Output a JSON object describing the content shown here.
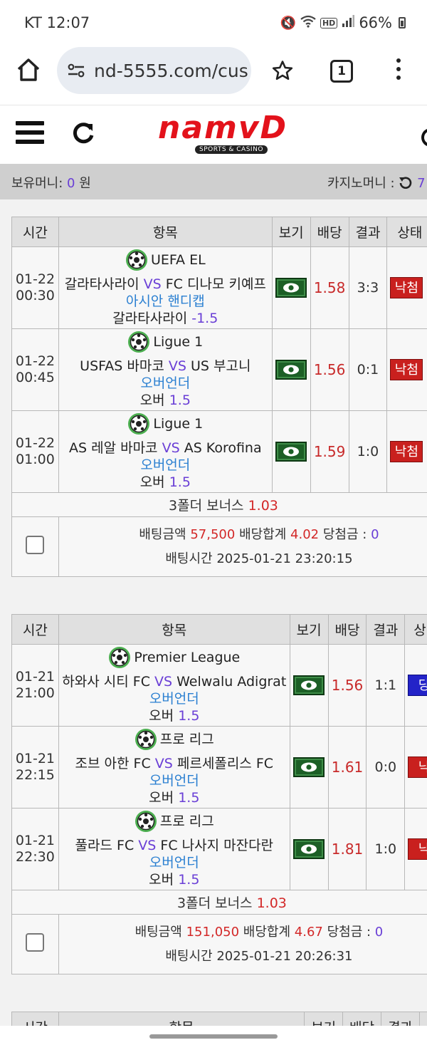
{
  "status_bar": {
    "carrier_time": "KT 12:07",
    "battery": "66%"
  },
  "browser": {
    "url": "nd-5555.com/cus",
    "tab_count": "1"
  },
  "site": {
    "logo": "namvD",
    "logo_sub": "SPORTS & CASINO"
  },
  "money_bar": {
    "holding_label": "보유머니:",
    "holding_value": "0",
    "holding_unit": "원",
    "casino_label": "카지노머니 :",
    "casino_value": "7"
  },
  "bet_slips": [
    {
      "headers": [
        "시간",
        "항목",
        "보기",
        "배당",
        "결과",
        "상태"
      ],
      "rows": [
        {
          "date": "01-22",
          "time": "00:30",
          "league": "UEFA EL",
          "home": "갈라타사라이",
          "vs": "VS",
          "away": "FC 디나모 키예프",
          "market": "아시안 핸디캡",
          "pick": "갈라타사라이",
          "pick_value": "-1.5",
          "odds": "1.58",
          "result": "3:3",
          "status": "낙첨",
          "status_color": "#c9201e"
        },
        {
          "date": "01-22",
          "time": "00:45",
          "league": "Ligue 1",
          "home": "USFAS 바마코",
          "vs": "VS",
          "away": "US 부고니",
          "market": "오버언더",
          "pick": "오버",
          "pick_value": "1.5",
          "odds": "1.56",
          "result": "0:1",
          "status": "낙첨",
          "status_color": "#c9201e"
        },
        {
          "date": "01-22",
          "time": "01:00",
          "league": "Ligue 1",
          "home": "AS 레알 바마코",
          "vs": "VS",
          "away": "AS Korofina",
          "market": "오버언더",
          "pick": "오버",
          "pick_value": "1.5",
          "odds": "1.59",
          "result": "1:0",
          "status": "낙첨",
          "status_color": "#c9201e"
        }
      ],
      "bonus_label": "3폴더 보너스",
      "bonus_value": "1.03",
      "amount_label": "배팅금액",
      "amount_value": "57,500",
      "total_odds_label": "배당합계",
      "total_odds_value": "4.02",
      "win_label": "당첨금 :",
      "win_value": "0",
      "bet_time_label": "배팅시간",
      "bet_time_value": "2025-01-21 23:20:15"
    },
    {
      "headers": [
        "시간",
        "항목",
        "보기",
        "배당",
        "결과",
        "상"
      ],
      "rows": [
        {
          "date": "01-21",
          "time": "21:00",
          "league": "Premier League",
          "home": "하와사 시티 FC",
          "vs": "VS",
          "away": "Welwalu Adigrat",
          "market": "오버언더",
          "pick": "오버",
          "pick_value": "1.5",
          "odds": "1.56",
          "result": "1:1",
          "status": "당",
          "status_color": "#2323c8"
        },
        {
          "date": "01-21",
          "time": "22:15",
          "league": "프로 리그",
          "home": "조브 아한 FC",
          "vs": "VS",
          "away": "페르세폴리스 FC",
          "market": "오버언더",
          "pick": "오버",
          "pick_value": "1.5",
          "odds": "1.61",
          "result": "0:0",
          "status": "낙",
          "status_color": "#c9201e"
        },
        {
          "date": "01-21",
          "time": "22:30",
          "league": "프로 리그",
          "home": "풀라드 FC",
          "vs": "VS",
          "away": "FC 나사지 마잔다란",
          "market": "오버언더",
          "pick": "오버",
          "pick_value": "1.5",
          "odds": "1.81",
          "result": "1:0",
          "status": "낙",
          "status_color": "#c9201e"
        }
      ],
      "bonus_label": "3폴더 보너스",
      "bonus_value": "1.03",
      "amount_label": "배팅금액",
      "amount_value": "151,050",
      "total_odds_label": "배당합계",
      "total_odds_value": "4.67",
      "win_label": "당첨금 :",
      "win_value": "0",
      "bet_time_label": "배팅시간",
      "bet_time_value": "2025-01-21 20:26:31"
    },
    {
      "headers": [
        "시간",
        "항목",
        "보기",
        "배당",
        "결과"
      ]
    }
  ]
}
